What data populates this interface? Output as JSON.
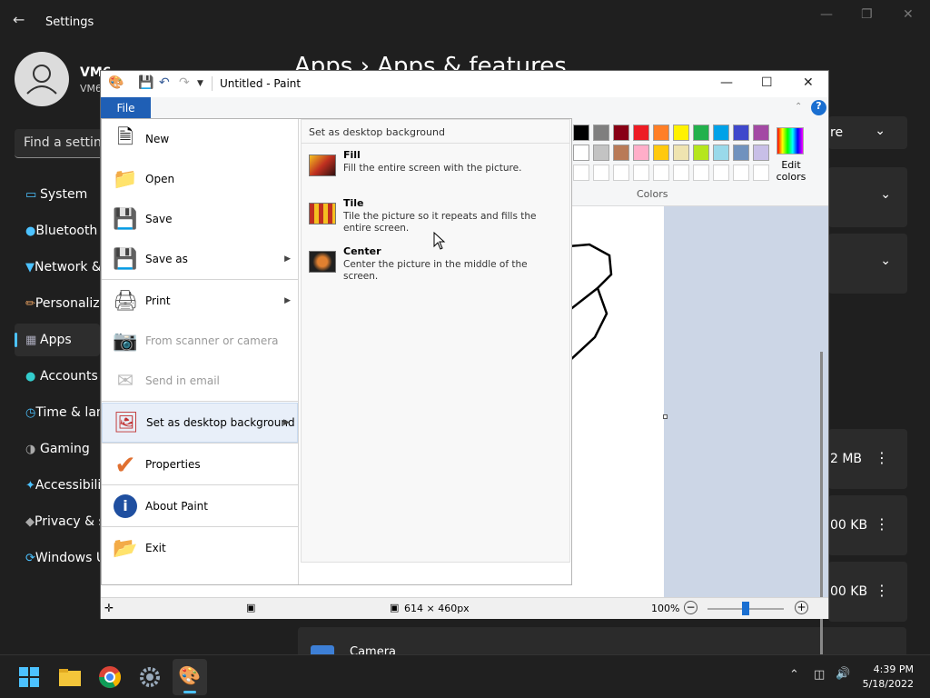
{
  "settings": {
    "title": "Settings",
    "user_name": "VM6",
    "user_sub": "VM6",
    "search_placeholder": "Find a setting",
    "breadcrumb": "Apps  ›  Apps & features",
    "nav": [
      {
        "label": "System",
        "icon": "monitor-icon"
      },
      {
        "label": "Bluetooth & devices",
        "icon": "bluetooth-icon"
      },
      {
        "label": "Network & internet",
        "icon": "wifi-icon"
      },
      {
        "label": "Personalization",
        "icon": "brush-icon"
      },
      {
        "label": "Apps",
        "icon": "apps-icon"
      },
      {
        "label": "Accounts",
        "icon": "person-icon"
      },
      {
        "label": "Time & language",
        "icon": "clock-icon"
      },
      {
        "label": "Gaming",
        "icon": "gamepad-icon"
      },
      {
        "label": "Accessibility",
        "icon": "accessibility-icon"
      },
      {
        "label": "Privacy & security",
        "icon": "shield-icon"
      },
      {
        "label": "Windows Update",
        "icon": "update-icon"
      }
    ],
    "cards": [
      {
        "text": "re"
      },
      {
        "text": ""
      },
      {
        "text": ""
      },
      {
        "text": "2 MB"
      },
      {
        "text": "00 KB"
      },
      {
        "text": "00 KB"
      }
    ],
    "camera_label": "Camera"
  },
  "paint": {
    "title": "Untitled - Paint",
    "file_tab": "File",
    "colors_label": "Colors",
    "edit_colors_label": "Edit colors",
    "status_size": "614 × 460px",
    "zoom": "100%",
    "palette_row1": [
      "#000000",
      "#7f7f7f",
      "#880015",
      "#ed1c24",
      "#ff7f27",
      "#fff200",
      "#22b14c",
      "#00a2e8",
      "#3f48cc",
      "#a349a4"
    ],
    "palette_row2": [
      "#ffffff",
      "#c3c3c3",
      "#b97a57",
      "#ffaec9",
      "#ffc90e",
      "#efe4b0",
      "#b5e61d",
      "#99d9ea",
      "#7092be",
      "#c8bfe7"
    ]
  },
  "file_menu": {
    "items": [
      {
        "label": "New",
        "icon": "new-file-icon",
        "disabled": false
      },
      {
        "label": "Open",
        "icon": "open-folder-icon",
        "disabled": false
      },
      {
        "label": "Save",
        "icon": "save-icon",
        "disabled": false
      },
      {
        "label": "Save as",
        "icon": "save-as-icon",
        "disabled": false
      },
      {
        "label": "Print",
        "icon": "print-icon",
        "disabled": false
      },
      {
        "label": "From scanner or camera",
        "icon": "scanner-icon",
        "disabled": true
      },
      {
        "label": "Send in email",
        "icon": "email-icon",
        "disabled": true
      },
      {
        "label": "Set as desktop background",
        "icon": "desktop-background-icon",
        "disabled": false
      },
      {
        "label": "Properties",
        "icon": "checkmark-icon",
        "disabled": false
      },
      {
        "label": "About Paint",
        "icon": "info-icon",
        "disabled": false
      },
      {
        "label": "Exit",
        "icon": "exit-icon",
        "disabled": false
      }
    ],
    "submenu": {
      "title": "Set as desktop background",
      "options": [
        {
          "title": "Fill",
          "desc": "Fill the entire screen with the picture."
        },
        {
          "title": "Tile",
          "desc": "Tile the picture so it repeats and fills the entire screen."
        },
        {
          "title": "Center",
          "desc": "Center the picture in the middle of the screen."
        }
      ]
    }
  },
  "taskbar": {
    "time": "4:39 PM",
    "date": "5/18/2022"
  }
}
